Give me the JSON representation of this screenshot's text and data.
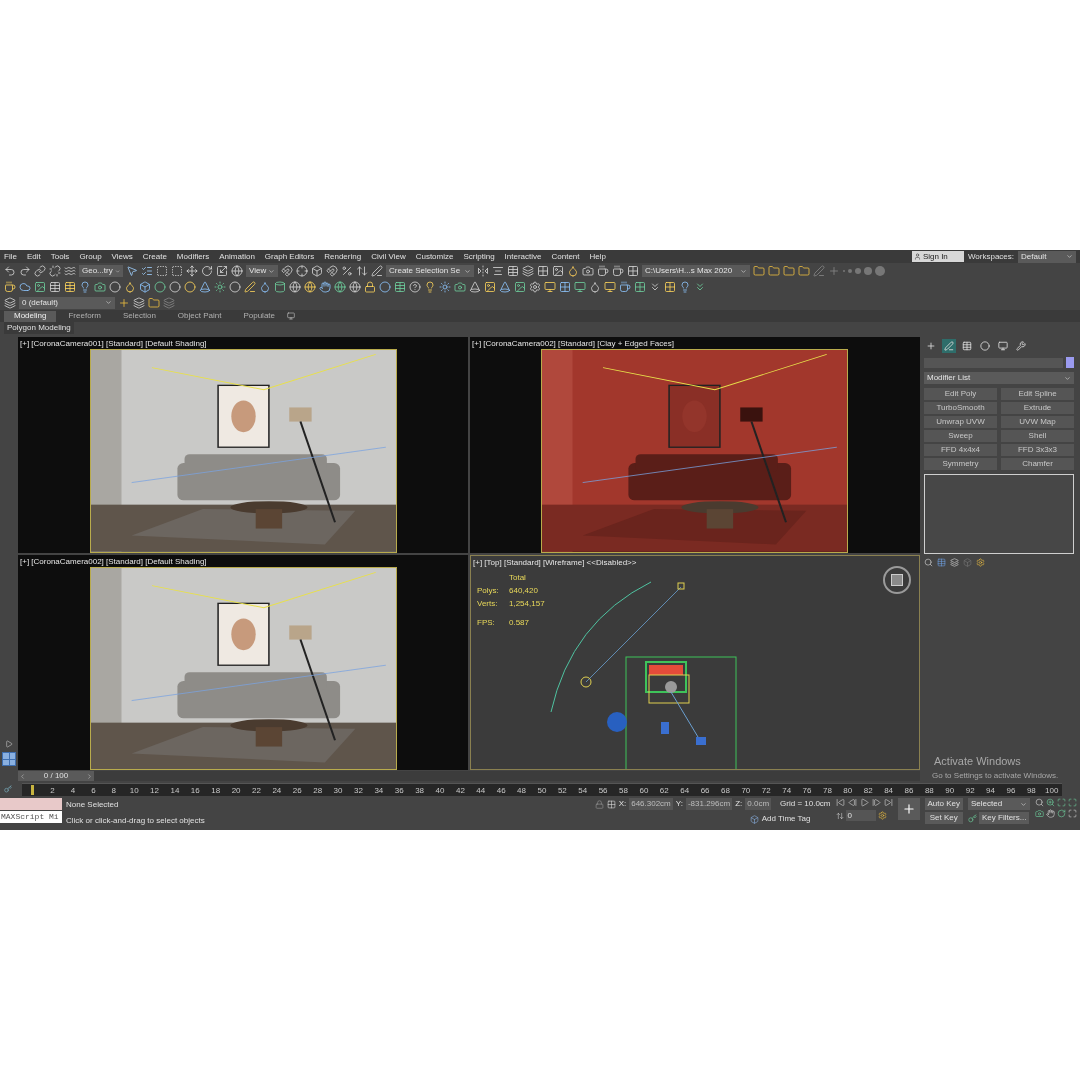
{
  "menu_bar": {
    "items": [
      "File",
      "Edit",
      "Tools",
      "Group",
      "Views",
      "Create",
      "Modifiers",
      "Animation",
      "Graph Editors",
      "Rendering",
      "Civil View",
      "Customize",
      "Scripting",
      "Interactive",
      "Content",
      "Help"
    ],
    "sign_in": "Sign In",
    "workspaces_label": "Workspaces:",
    "workspace": "Default"
  },
  "main_toolbar": {
    "selection_filter": "Geo...try",
    "reference_coordinate": "View",
    "named_selection": "Create Selection Se",
    "project_path": "C:\\Users\\H...s Max 2020"
  },
  "layer_toolbar": {
    "layer": "0 (default)"
  },
  "ribbon": {
    "tabs": [
      {
        "label": "Modeling",
        "selected": true
      },
      {
        "label": "Freeform",
        "selected": false
      },
      {
        "label": "Selection",
        "selected": false
      },
      {
        "label": "Object Paint",
        "selected": false
      },
      {
        "label": "Populate",
        "selected": false
      }
    ],
    "panel": "Polygon Modeling"
  },
  "viewports": [
    {
      "label": "[+] [CoronaCamera001] [Standard] [Default Shading]",
      "kind": "render"
    },
    {
      "label": "[+] [CoronaCamera002] [Standard] [Clay + Edged Faces]",
      "kind": "clay"
    },
    {
      "label": "[+] [CoronaCamera002] [Standard] [Default Shading]",
      "kind": "render"
    },
    {
      "label": "[+] [Top] [Standard] [Wireframe] <<Disabled>>",
      "kind": "wireframe",
      "stats": {
        "title": "Total",
        "rows": [
          {
            "label": "Polys:",
            "value": "640,420"
          },
          {
            "label": "Verts:",
            "value": "1,254,157"
          },
          {
            "label": "FPS:",
            "value": "0.587"
          }
        ]
      }
    }
  ],
  "command_panel": {
    "tabs": [
      {
        "selected": false
      },
      {
        "selected": true
      },
      {
        "selected": false
      },
      {
        "selected": false
      },
      {
        "selected": false
      },
      {
        "selected": false
      }
    ],
    "color": "#9b9bf0",
    "modifier_list": "Modifier List",
    "modifier_buttons": [
      "Edit Poly",
      "Edit Spline",
      "TurboSmooth",
      "Extrude",
      "Unwrap UVW",
      "UVW Map",
      "Sweep",
      "Shell",
      "FFD 4x4x4",
      "FFD 3x3x3",
      "Symmetry",
      "Chamfer"
    ]
  },
  "time_slider": {
    "position": "0 / 100",
    "level": 0
  },
  "track_bar": {
    "frame_labels": [
      "2",
      "4",
      "6",
      "8",
      "10",
      "12",
      "14",
      "16",
      "18",
      "20",
      "22",
      "24",
      "26",
      "28",
      "30",
      "32",
      "34",
      "36",
      "38",
      "40",
      "42",
      "44",
      "46",
      "48",
      "50",
      "52",
      "54",
      "56",
      "58",
      "60",
      "62",
      "64",
      "66",
      "68",
      "70",
      "72",
      "74",
      "76",
      "78",
      "80",
      "82",
      "84",
      "86",
      "88",
      "90",
      "92",
      "94",
      "96",
      "98",
      "100"
    ]
  },
  "watermark": {
    "title": "Activate Windows",
    "subtitle": "Go to Settings to activate Windows."
  },
  "status_bar": {
    "maxscript": "MAXScript Mi",
    "selection": "None Selected",
    "prompt": "Click or click-and-drag to select objects",
    "x_label": "X:",
    "x_value": "646.302cm",
    "y_label": "Y:",
    "y_value": "-831.296cm",
    "z_label": "Z:",
    "z_value": "0.0cm",
    "grid": "Grid = 10.0cm",
    "add_time_tag": "Add Time Tag",
    "auto_key": "Auto Key",
    "set_key": "Set Key",
    "key_mode": "Selected",
    "key_filters": "Key Filters...",
    "current_frame": "0"
  }
}
